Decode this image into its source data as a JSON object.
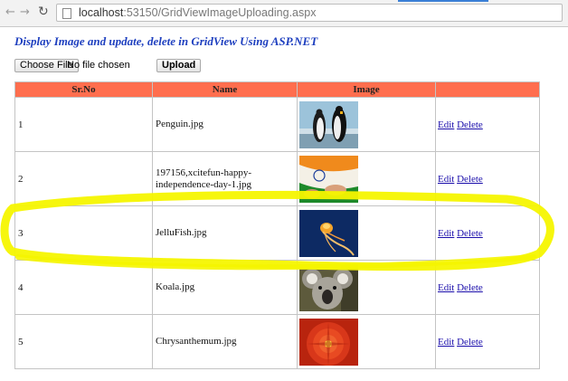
{
  "browser": {
    "url_host": "localhost",
    "url_rest": ":53150/GridViewImageUploading.aspx"
  },
  "page": {
    "title": "Display Image and update, delete in GridView Using ASP.NET",
    "choose_file_label": "Choose File",
    "no_file_text": "No file chosen",
    "upload_label": "Upload"
  },
  "grid": {
    "header_color": "#ff6e4e",
    "columns": [
      "Sr.No",
      "Name",
      "Image",
      ""
    ],
    "rows": [
      {
        "sr": "1",
        "name": "Penguin.jpg",
        "image_icon": "penguins-photo",
        "edit": "Edit",
        "delete": "Delete"
      },
      {
        "sr": "2",
        "name": "197156,xcitefun-happy-independence-day-1.jpg",
        "image_icon": "flag-hands-photo",
        "edit": "Edit",
        "delete": "Delete"
      },
      {
        "sr": "3",
        "name": "JelluFish.jpg",
        "image_icon": "jellyfish-photo",
        "edit": "Edit",
        "delete": "Delete"
      },
      {
        "sr": "4",
        "name": "Koala.jpg",
        "image_icon": "koala-photo",
        "edit": "Edit",
        "delete": "Delete"
      },
      {
        "sr": "5",
        "name": "Chrysanthemum.jpg",
        "image_icon": "chrysanthemum-photo",
        "edit": "Edit",
        "delete": "Delete"
      }
    ]
  },
  "annotation": {
    "highlight_color": "#f5f500",
    "highlighted_row": "3"
  }
}
